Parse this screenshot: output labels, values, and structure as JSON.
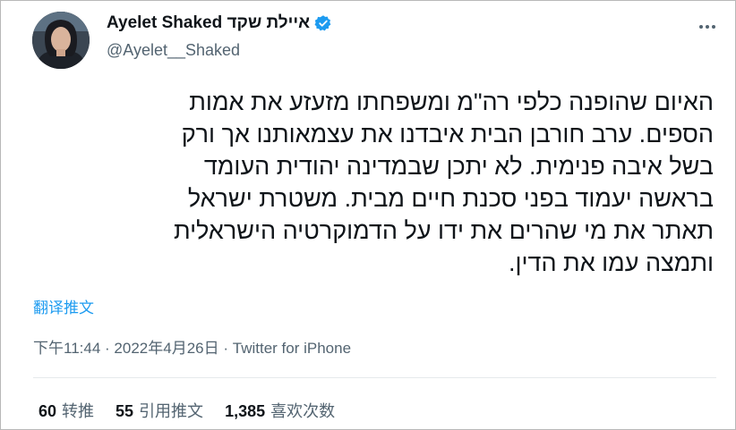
{
  "author": {
    "display_name": "Ayelet Shaked איילת שקד",
    "handle": "@Ayelet__Shaked",
    "verified": true
  },
  "tweet": {
    "lines": [
      "האיום שהופנה כלפי רה\"מ ומשפחתו מזעזע את אמות",
      "הספים. ערב חורבן הבית איבדנו את עצמאותנו אך ורק",
      "בשל איבה פנימית. לא יתכן שבמדינה יהודית העומד",
      "בראשה יעמוד בפני סכנת חיים מבית. משטרת ישראל",
      "תאתר את מי שהרים את ידו על הדמוקרטיה הישראלית",
      "ותמצה עמו את הדין."
    ]
  },
  "translate_label": "翻译推文",
  "meta": {
    "time": "下午11:44",
    "date": "2022年4月26日",
    "separator": "·",
    "source": "Twitter for iPhone"
  },
  "stats": [
    {
      "count": "60",
      "label": "转推"
    },
    {
      "count": "55",
      "label": "引用推文"
    },
    {
      "count": "1,385",
      "label": "喜欢次数"
    }
  ],
  "colors": {
    "accent": "#1d9bf0",
    "text": "#0f1419",
    "secondary": "#536471"
  }
}
